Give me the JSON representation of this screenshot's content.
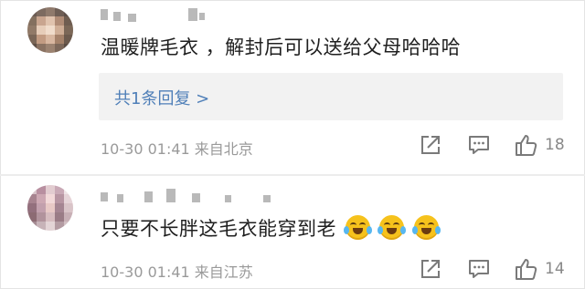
{
  "comments": [
    {
      "text": "温暖牌毛衣 ，解封后可以送给父母哈哈哈",
      "reply_link": "共1条回复 >",
      "time": "10-30 01:41",
      "location": "来自北京",
      "likes": "18",
      "avatar_colors": [
        "#6b5a52",
        "#7d6b60",
        "#8f7a6c",
        "#6e5e55",
        "#5d4f48",
        "#84705f",
        "#c9a58f",
        "#e0c3ae",
        "#b08c76",
        "#6f5d50",
        "#917a68",
        "#e6cdb9",
        "#f0dccb",
        "#cfae96",
        "#7b6757",
        "#7a6657",
        "#c29b82",
        "#d8b7a0",
        "#a5826a",
        "#6c5a4d",
        "#5f4f45",
        "#8a7262",
        "#9c8371",
        "#7d685a",
        "#5b4c43"
      ]
    },
    {
      "text": "只要不长胖这毛衣能穿到老",
      "emoji_count": 3,
      "emoji_name": "laugh-cry-emoji",
      "time": "10-30 01:41",
      "location": "来自江苏",
      "likes": "14",
      "avatar_colors": [
        "#d7c2c8",
        "#b88fa0",
        "#e2ccd0",
        "#c9a9b6",
        "#efe4e6",
        "#a7838f",
        "#cda8b3",
        "#f2d9d9",
        "#b795a2",
        "#e6d4d8",
        "#93707d",
        "#c2a0ad",
        "#e8c9c6",
        "#a58592",
        "#d9c4c8",
        "#8c6b73",
        "#b1939c",
        "#d6bcbf",
        "#9a7c86",
        "#c8b0b6",
        "#a48a92",
        "#c7b3b8",
        "#e3d4d6",
        "#b39ba2",
        "#d2c0c4"
      ]
    }
  ],
  "colors": {
    "link": "#4f7fb8",
    "meta": "#9a9a9a",
    "icon": "#7a7a7a"
  },
  "icons": [
    "share-icon",
    "comment-icon",
    "thumbs-up-icon"
  ]
}
